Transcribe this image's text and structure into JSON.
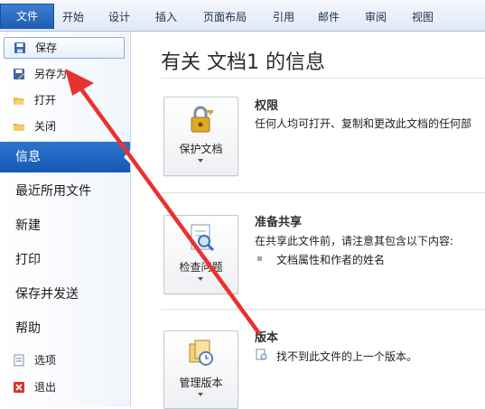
{
  "ribbon": {
    "tabs": [
      "文件",
      "开始",
      "设计",
      "插入",
      "页面布局",
      "引用",
      "邮件",
      "审阅",
      "视图"
    ]
  },
  "sidebar": {
    "small_top": [
      {
        "label": "保存",
        "icon": "save-icon"
      },
      {
        "label": "另存为",
        "icon": "save-as-icon"
      },
      {
        "label": "打开",
        "icon": "open-folder-icon"
      },
      {
        "label": "关闭",
        "icon": "close-folder-icon"
      }
    ],
    "big": [
      "信息",
      "最近所用文件",
      "新建",
      "打印",
      "保存并发送",
      "帮助"
    ],
    "small_bottom": [
      {
        "label": "选项",
        "icon": "options-icon"
      },
      {
        "label": "退出",
        "icon": "exit-icon"
      }
    ],
    "active": "信息"
  },
  "main": {
    "title": "有关 文档1 的信息",
    "sections": [
      {
        "button": "保护文档",
        "heading": "权限",
        "lines": [
          "任何人均可打开、复制和更改此文档的任何部"
        ],
        "bullet": null
      },
      {
        "button": "检查问题",
        "heading": "准备共享",
        "lines": [
          "在共享此文件前，请注意其包含以下内容:"
        ],
        "bullet": "文档属性和作者的姓名"
      },
      {
        "button": "管理版本",
        "heading": "版本",
        "lines": [
          "找不到此文件的上一个版本。"
        ],
        "bullet": null
      }
    ]
  },
  "colors": {
    "accent": "#1e5bb0",
    "arrow": "#e8322f"
  }
}
